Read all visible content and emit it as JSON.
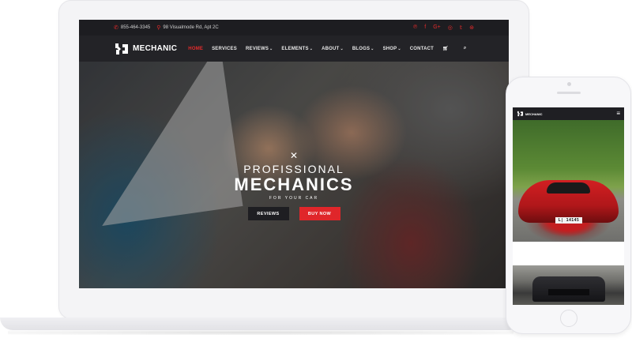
{
  "website": {
    "topbar": {
      "phone": "855-464-3345",
      "address": "98 Visualmode Rd, Apt 2C",
      "social_icons": [
        "pinterest-icon",
        "facebook-icon",
        "google-plus-icon",
        "instagram-icon",
        "twitter-icon",
        "dribbble-icon"
      ]
    },
    "logo_text": "MECHANIC",
    "nav": [
      {
        "label": "HOME",
        "active": true,
        "dropdown": false
      },
      {
        "label": "SERVICES",
        "active": false,
        "dropdown": false
      },
      {
        "label": "REVIEWS",
        "active": false,
        "dropdown": true
      },
      {
        "label": "ELEMENTS",
        "active": false,
        "dropdown": true
      },
      {
        "label": "ABOUT",
        "active": false,
        "dropdown": true
      },
      {
        "label": "BLOGS",
        "active": false,
        "dropdown": true
      },
      {
        "label": "SHOP",
        "active": false,
        "dropdown": true
      },
      {
        "label": "CONTACT",
        "active": false,
        "dropdown": false
      }
    ],
    "hero": {
      "line1": "PROFISSIONAL",
      "line2": "MECHANICS",
      "tagline": "FOR YOUR CAR",
      "button_reviews": "REVIEWS",
      "button_buy": "BUY NOW"
    }
  },
  "phone": {
    "logo_text": "MECHANIC",
    "plate_text": "L| 14145"
  },
  "colors": {
    "accent": "#e52b2b",
    "nav_bg": "#232327",
    "topbar_bg": "#1d1d21"
  }
}
